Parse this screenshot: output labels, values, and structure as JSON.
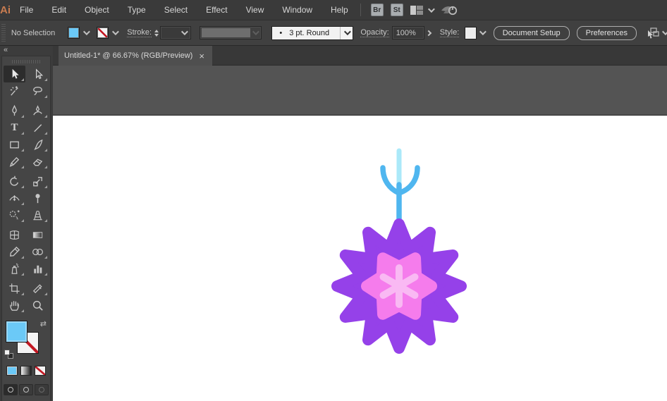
{
  "window": {
    "collapse_glyph": "«",
    "swap_glyph": "⇄"
  },
  "menubar": {
    "logo": "Ai",
    "items": [
      "File",
      "Edit",
      "Object",
      "Type",
      "Select",
      "Effect",
      "View",
      "Window",
      "Help"
    ],
    "br": "Br",
    "st": "St"
  },
  "controlbar": {
    "selection_status": "No Selection",
    "stroke_label": "Stroke:",
    "brush_bullet": "•",
    "brush_value": "3 pt. Round",
    "opacity_label": "Opacity:",
    "opacity_value": "100%",
    "style_label": "Style:",
    "document_setup": "Document Setup",
    "preferences": "Preferences"
  },
  "tabbar": {
    "title": "Untitled-1* @ 66.67% (RGB/Preview)",
    "close": "×"
  },
  "toolbar": {
    "type_glyph": "T",
    "tools": [
      "selection",
      "direct-selection",
      "magic-wand",
      "lasso",
      "pen",
      "curvature",
      "type",
      "line-segment",
      "rectangle",
      "paintbrush",
      "shaper",
      "eraser",
      "rotate",
      "scale",
      "width",
      "puppet-warp",
      "shape-builder",
      "perspective-grid",
      "mesh",
      "gradient",
      "eyedropper",
      "blend",
      "symbol-sprayer",
      "column-graph",
      "artboard",
      "slice",
      "hand",
      "zoom"
    ]
  },
  "swatches": {
    "fill_color": "#6bc9f7"
  },
  "artwork": {
    "stem_light": "#abe9f9",
    "stem_blue": "#4fb6ef",
    "burst_purple": "#9541e9",
    "star_pink": "#f57cec",
    "asterisk_pink": "#f9b9f3"
  }
}
